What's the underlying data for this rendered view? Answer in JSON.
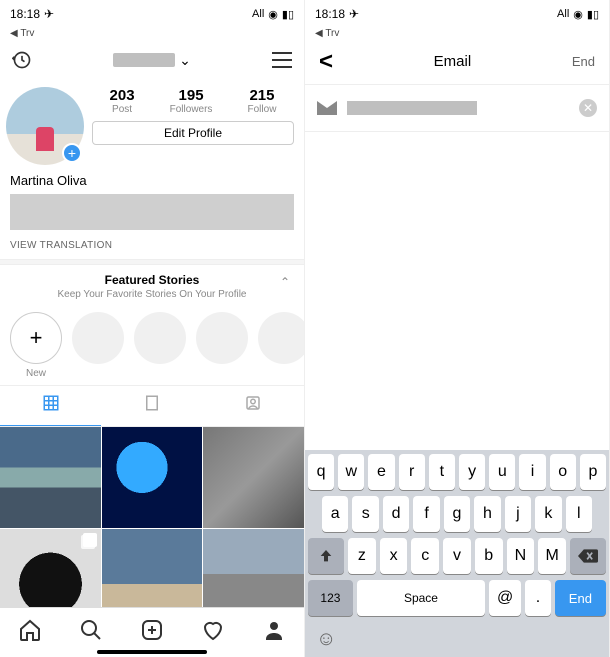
{
  "left": {
    "status": {
      "time": "18:18",
      "carrier": "All"
    },
    "trv": "Trv",
    "profile": {
      "posts": "203",
      "posts_lbl": "Post",
      "followers": "195",
      "followers_lbl": "Followers",
      "following": "215",
      "following_lbl": "Follow",
      "edit_label": "Edit Profile",
      "display_name": "Martina Oliva",
      "view_translation": "VIEW TRANSLATION"
    },
    "featured": {
      "title": "Featured Stories",
      "subtitle": "Keep Your Favorite Stories On Your Profile",
      "new_label": "New"
    }
  },
  "right": {
    "status": {
      "time": "18:18",
      "carrier": "All"
    },
    "trv": "Trv",
    "nav": {
      "title": "Email",
      "end": "End"
    },
    "keyboard": {
      "row1": [
        "q",
        "w",
        "e",
        "r",
        "t",
        "y",
        "u",
        "i",
        "o",
        "p"
      ],
      "row2": [
        "a",
        "s",
        "d",
        "f",
        "g",
        "h",
        "j",
        "k",
        "l"
      ],
      "row3": [
        "z",
        "x",
        "c",
        "v",
        "b",
        "N",
        "M"
      ],
      "mode": "123",
      "space": "Space",
      "at": "@",
      "dot": ".",
      "send": "End"
    }
  }
}
